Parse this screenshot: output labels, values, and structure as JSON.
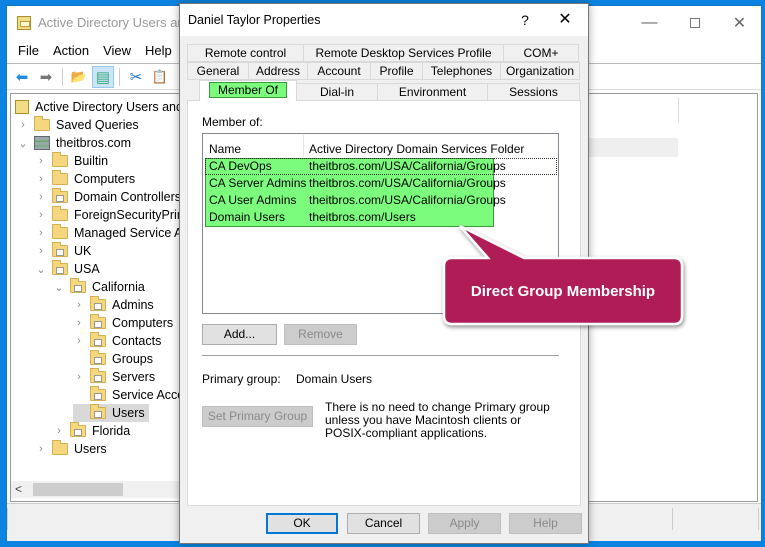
{
  "mmc": {
    "title": "Active Directory Users and Computers",
    "title_visible": "Active Directory Users and C",
    "window_controls": {
      "minimize": "—",
      "maximize": "",
      "close": "✕"
    },
    "menu": [
      "File",
      "Action",
      "View",
      "Help"
    ],
    "toolbar": [
      {
        "icon": "back-arrow-icon",
        "glyph": "⬅"
      },
      {
        "icon": "forward-arrow-icon",
        "glyph": "➡"
      },
      {
        "icon": "up-folder-icon",
        "glyph": "📂"
      },
      {
        "icon": "show-hide-console-tree-icon",
        "glyph": "▤"
      },
      {
        "icon": "cut-icon",
        "glyph": "✂"
      },
      {
        "icon": "clipboard-icon",
        "glyph": "📋"
      }
    ],
    "tree": {
      "root": "Active Directory Users and Computers",
      "items": [
        {
          "label": "Saved Queries",
          "level": 1,
          "chevron": ">",
          "type": "folder"
        },
        {
          "label": "theitbros.com",
          "level": 1,
          "chevron": "v",
          "type": "domain"
        },
        {
          "label": "Builtin",
          "level": 2,
          "chevron": ">",
          "type": "folder"
        },
        {
          "label": "Computers",
          "level": 2,
          "chevron": ">",
          "type": "folder"
        },
        {
          "label": "Domain Controllers",
          "level": 2,
          "chevron": ">",
          "type": "ou"
        },
        {
          "label": "ForeignSecurityPrincipals",
          "level": 2,
          "chevron": ">",
          "type": "folder"
        },
        {
          "label": "Managed Service Accounts",
          "level": 2,
          "chevron": ">",
          "type": "folder"
        },
        {
          "label": "UK",
          "level": 2,
          "chevron": ">",
          "type": "ou"
        },
        {
          "label": "USA",
          "level": 2,
          "chevron": "v",
          "type": "ou"
        },
        {
          "label": "California",
          "level": 3,
          "chevron": "v",
          "type": "ou"
        },
        {
          "label": "Admins",
          "level": 4,
          "chevron": ">",
          "type": "ou"
        },
        {
          "label": "Computers",
          "level": 4,
          "chevron": ">",
          "type": "ou"
        },
        {
          "label": "Contacts",
          "level": 4,
          "chevron": ">",
          "type": "ou"
        },
        {
          "label": "Groups",
          "level": 4,
          "chevron": "",
          "type": "ou"
        },
        {
          "label": "Servers",
          "level": 4,
          "chevron": ">",
          "type": "ou"
        },
        {
          "label": "Service Accounts",
          "level": 4,
          "chevron": "",
          "type": "ou"
        },
        {
          "label": "Users",
          "level": 4,
          "chevron": "",
          "type": "ou",
          "selected": true
        },
        {
          "label": "Florida",
          "level": 3,
          "chevron": ">",
          "type": "ou"
        },
        {
          "label": "Users",
          "level": 2,
          "chevron": ">",
          "type": "folder"
        }
      ]
    },
    "scroll_left": "<"
  },
  "dialog": {
    "title": "Daniel Taylor Properties",
    "help_glyph": "?",
    "close_glyph": "✕",
    "tabs_row1": [
      "Remote control",
      "Remote Desktop Services Profile",
      "COM+"
    ],
    "tabs_row2": [
      "General",
      "Address",
      "Account",
      "Profile",
      "Telephones",
      "Organization"
    ],
    "tabs_row3": [
      "Member Of",
      "Dial-in",
      "Environment",
      "Sessions"
    ],
    "active_tab": "Member Of",
    "member_of_label": "Member of:",
    "columns": [
      "Name",
      "Active Directory Domain Services Folder"
    ],
    "groups": [
      {
        "name": "CA DevOps",
        "folder": "theitbros.com/USA/California/Groups"
      },
      {
        "name": "CA Server Admins",
        "folder": "theitbros.com/USA/California/Groups"
      },
      {
        "name": "CA User Admins",
        "folder": "theitbros.com/USA/California/Groups"
      },
      {
        "name": "Domain Users",
        "folder": "theitbros.com/Users"
      }
    ],
    "add_button": "Add...",
    "remove_button": "Remove",
    "primary_group_label": "Primary group:",
    "primary_group_value": "Domain Users",
    "set_primary_button": "Set Primary Group",
    "primary_note": "There is no need to change Primary group unless you have Macintosh clients or POSIX-compliant applications.",
    "ok_button": "OK",
    "cancel_button": "Cancel",
    "apply_button": "Apply",
    "help_button": "Help"
  },
  "callout": {
    "text": "Direct Group Membership",
    "color": "#b01a54",
    "highlight_color": "#7cfc7c"
  }
}
